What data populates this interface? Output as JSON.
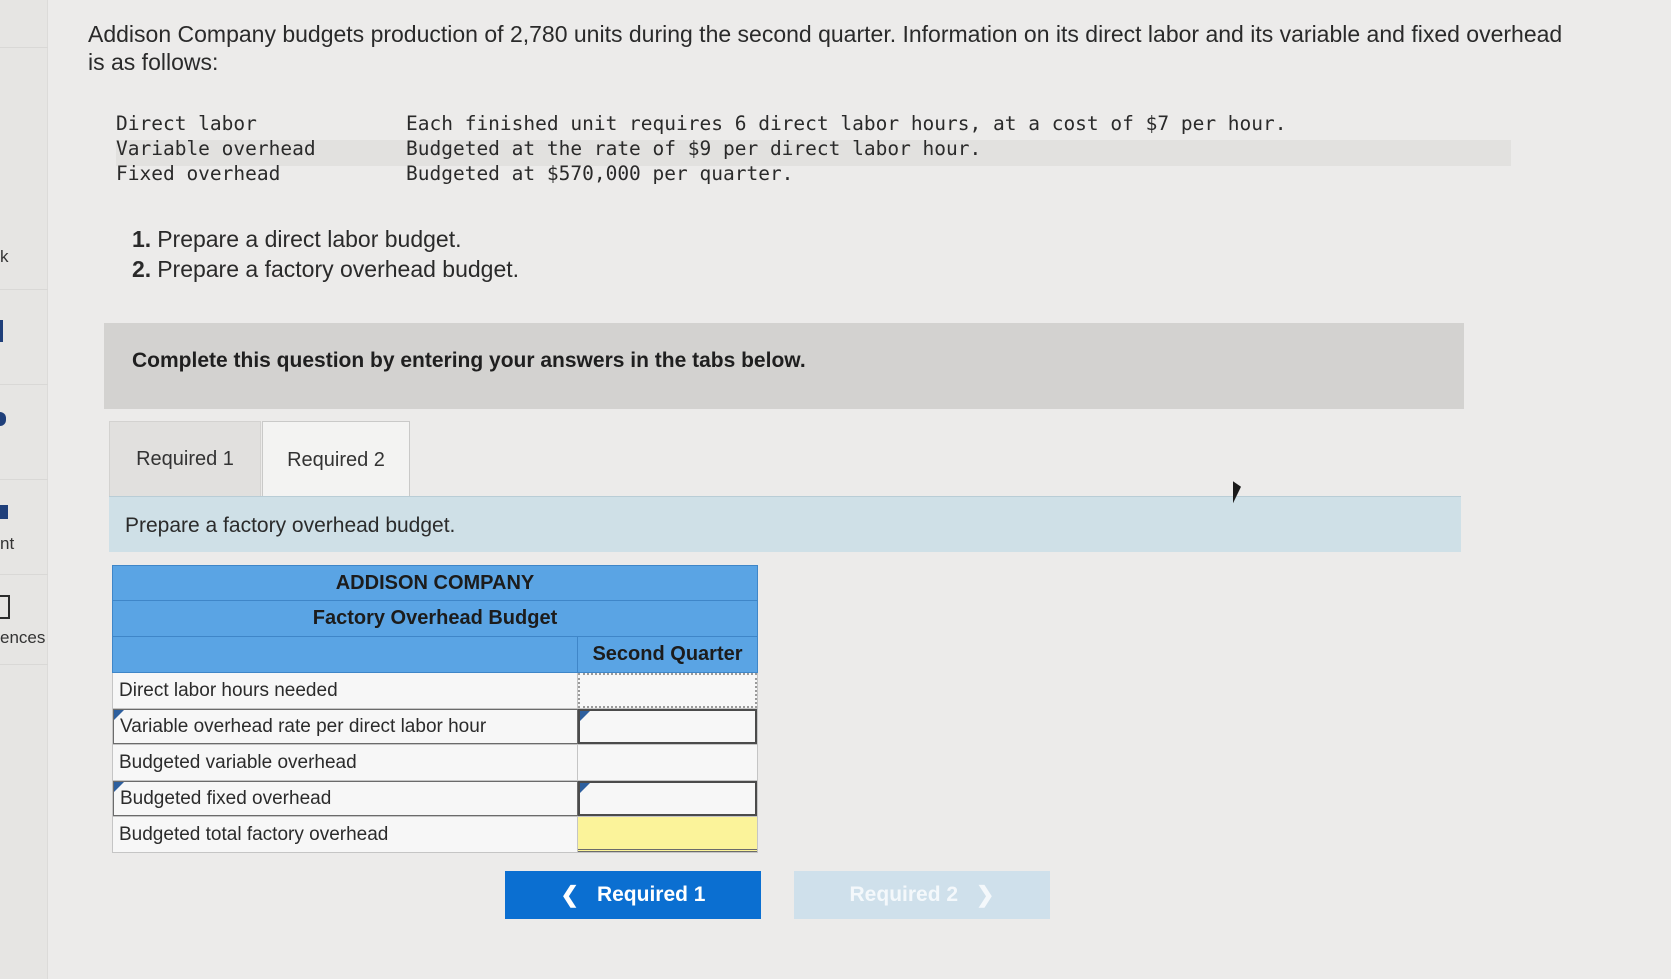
{
  "sidebar_fragments": [
    "k",
    "nt",
    "ences"
  ],
  "problem": {
    "intro": "Addison Company budgets production of 2,780 units during the second quarter. Information on its direct labor and its variable and fixed overhead is as follows:",
    "info": [
      {
        "label": "Direct labor",
        "value": "Each finished unit requires 6 direct labor hours, at a cost of $7 per hour."
      },
      {
        "label": "Variable overhead",
        "value": "Budgeted at the rate of $9 per direct labor hour."
      },
      {
        "label": "Fixed overhead",
        "value": "Budgeted at $570,000 per quarter."
      }
    ],
    "tasks": [
      {
        "num": "1.",
        "text": "Prepare a direct labor budget."
      },
      {
        "num": "2.",
        "text": "Prepare a factory overhead budget."
      }
    ]
  },
  "complete_prompt": "Complete this question by entering your answers in the tabs below.",
  "tabs": [
    {
      "label": "Required 1",
      "active": false
    },
    {
      "label": "Required 2",
      "active": true
    }
  ],
  "instruction": "Prepare a factory overhead budget.",
  "budget": {
    "company": "ADDISON COMPANY",
    "title": "Factory Overhead Budget",
    "column": "Second Quarter",
    "rows": [
      {
        "label": "Direct labor hours needed",
        "value": ""
      },
      {
        "label": "Variable overhead rate per direct labor hour",
        "value": ""
      },
      {
        "label": "Budgeted variable overhead",
        "value": ""
      },
      {
        "label": "Budgeted fixed overhead",
        "value": ""
      },
      {
        "label": "Budgeted total factory overhead",
        "value": ""
      }
    ]
  },
  "nav": {
    "prev_label": "Required 1",
    "next_label": "Required 2"
  },
  "colors": {
    "table_header": "#5aa4e4",
    "primary_button": "#0b6fd1",
    "disabled_button": "#cfe0eb",
    "total_highlight": "#fbf39a",
    "instruction_bg": "#cfe0e7"
  }
}
